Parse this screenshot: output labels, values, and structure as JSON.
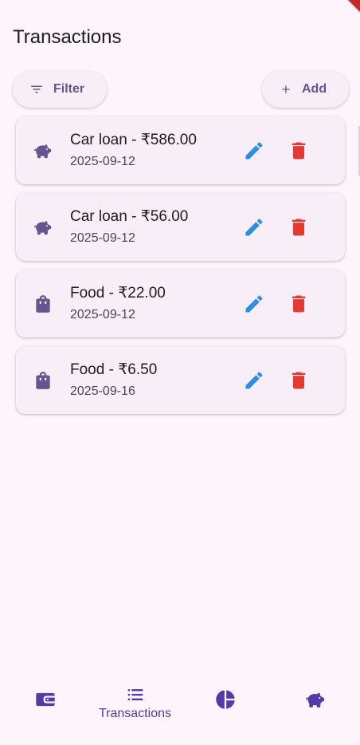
{
  "page": {
    "title": "Transactions"
  },
  "toolbar": {
    "filter_label": "Filter",
    "add_label": "Add"
  },
  "colors": {
    "background": "#fdf4fc",
    "card": "#f7eef8",
    "primary": "#65558f",
    "edit": "#2f8de4",
    "delete": "#e53935",
    "nav_active": "#523ba7"
  },
  "transactions": [
    {
      "title": "Car loan - ₹586.00",
      "date": "2025-09-12",
      "category_icon": "piggy-bank-icon"
    },
    {
      "title": "Car loan - ₹56.00",
      "date": "2025-09-12",
      "category_icon": "piggy-bank-icon"
    },
    {
      "title": "Food - ₹22.00",
      "date": "2025-09-12",
      "category_icon": "shopping-bag-icon"
    },
    {
      "title": "Food - ₹6.50",
      "date": "2025-09-16",
      "category_icon": "shopping-bag-icon"
    }
  ],
  "bottom_nav": {
    "items": [
      {
        "label": "",
        "icon": "wallet-icon",
        "active": false
      },
      {
        "label": "Transactions",
        "icon": "list-icon",
        "active": true
      },
      {
        "label": "",
        "icon": "pie-chart-icon",
        "active": false
      },
      {
        "label": "",
        "icon": "piggy-bank-icon",
        "active": false
      }
    ]
  }
}
